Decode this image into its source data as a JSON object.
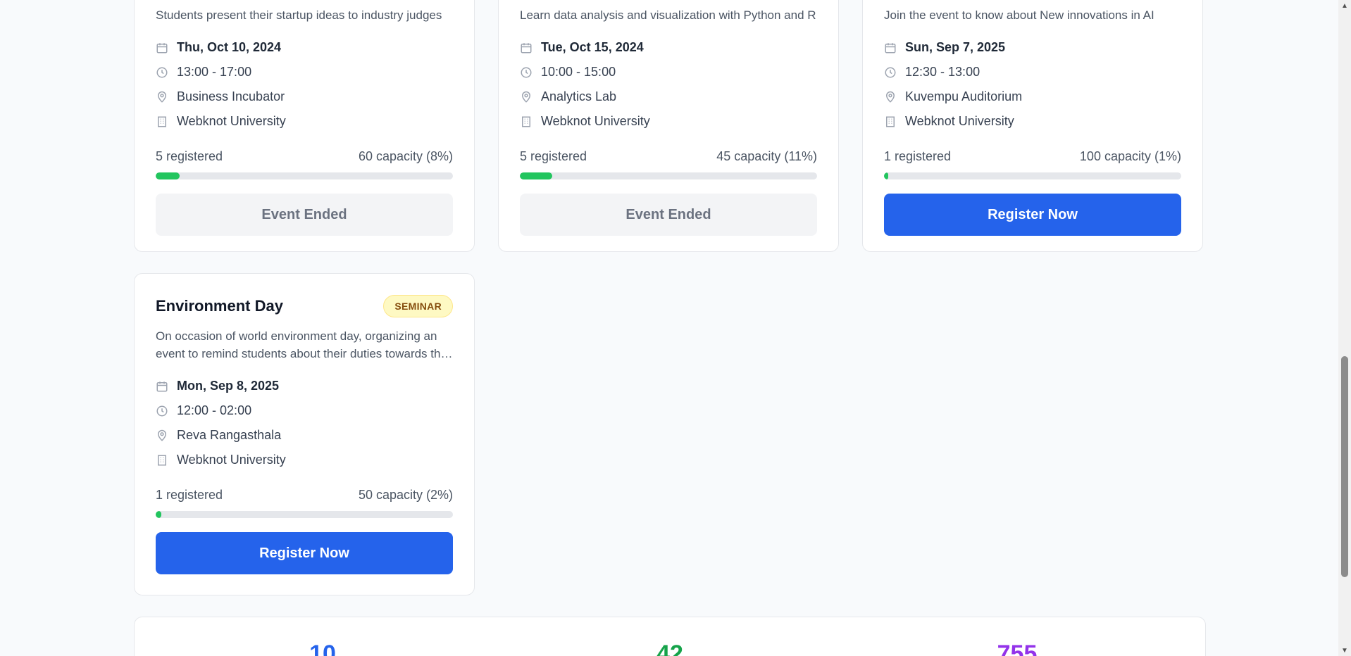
{
  "events": [
    {
      "description": "Students present their startup ideas to industry judges",
      "date": "Thu, Oct 10, 2024",
      "time": "13:00 - 17:00",
      "venue": "Business Incubator",
      "college": "Webknot University",
      "registered": "5 registered",
      "capacity": "60 capacity (8%)",
      "fill": 0.08,
      "button": "Event Ended"
    },
    {
      "description": "Learn data analysis and visualization with Python and R",
      "date": "Tue, Oct 15, 2024",
      "time": "10:00 - 15:00",
      "venue": "Analytics Lab",
      "college": "Webknot University",
      "registered": "5 registered",
      "capacity": "45 capacity (11%)",
      "fill": 0.11,
      "button": "Event Ended"
    },
    {
      "description": "Join the event to know about New innovations in AI",
      "date": "Sun, Sep 7, 2025",
      "time": "12:30 - 13:00",
      "venue": "Kuvempu Auditorium",
      "college": "Webknot University",
      "registered": "1 registered",
      "capacity": "100 capacity (1%)",
      "fill": 0.01,
      "button": "Register Now"
    },
    {
      "title": "Environment Day",
      "badge": "SEMINAR",
      "description": "On occasion of world environment day, organizing an event to remind students about their duties towards the environment",
      "date": "Mon, Sep 8, 2025",
      "time": "12:00 - 02:00",
      "venue": "Reva Rangasthala",
      "college": "Webknot University",
      "registered": "1 registered",
      "capacity": "50 capacity (2%)",
      "fill": 0.02,
      "button": "Register Now"
    }
  ],
  "summary": {
    "stat1": "10",
    "stat2": "42",
    "stat3": "755"
  },
  "colors": {
    "primary": "#2563eb",
    "progress": "#22c55e",
    "badge_bg": "#fef9c3",
    "stat1": "#2563eb",
    "stat2": "#16a34a",
    "stat3": "#9333ea"
  },
  "icons": [
    "calendar-icon",
    "clock-icon",
    "map-pin-icon",
    "building-icon"
  ]
}
